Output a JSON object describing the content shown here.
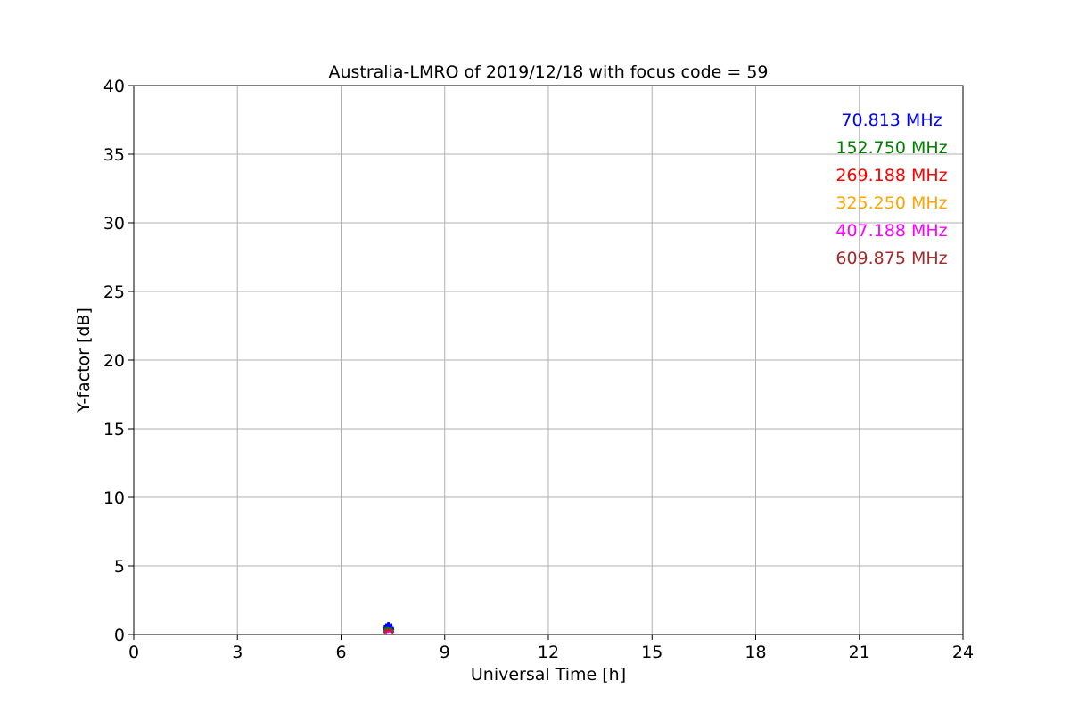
{
  "chart_data": {
    "type": "line",
    "title": "Australia-LMRO of 2019/12/18 with focus code = 59",
    "xlabel": "Universal Time [h]",
    "ylabel": "Y-factor [dB]",
    "xlim": [
      0,
      24
    ],
    "ylim": [
      0,
      40
    ],
    "xticks": [
      0,
      3,
      6,
      9,
      12,
      15,
      18,
      21,
      24
    ],
    "yticks": [
      0,
      5,
      10,
      15,
      20,
      25,
      30,
      35,
      40
    ],
    "xtick_labels": [
      "0",
      "3",
      "6",
      "9",
      "12",
      "15",
      "18",
      "21",
      "24"
    ],
    "ytick_labels": [
      "0",
      "5",
      "10",
      "15",
      "20",
      "25",
      "30",
      "35",
      "40"
    ],
    "grid": true,
    "legend_position": "top-right",
    "series": [
      {
        "name": "70.813 MHz",
        "color": "#0000ff",
        "x": [
          7.25,
          7.27,
          7.29,
          7.31,
          7.33,
          7.35,
          7.37,
          7.39,
          7.41,
          7.43,
          7.45,
          7.47,
          7.49,
          7.51
        ],
        "y": [
          0.3,
          0.7,
          0.4,
          0.8,
          0.5,
          0.6,
          0.9,
          0.4,
          0.7,
          0.5,
          0.8,
          0.4,
          0.6,
          0.3
        ]
      },
      {
        "name": "152.750 MHz",
        "color": "#008000",
        "x": [
          7.25,
          7.28,
          7.31,
          7.34,
          7.37,
          7.4,
          7.43,
          7.46,
          7.49,
          7.51
        ],
        "y": [
          0.2,
          0.4,
          0.3,
          0.5,
          0.4,
          0.45,
          0.35,
          0.4,
          0.3,
          0.2
        ]
      },
      {
        "name": "269.188 MHz",
        "color": "#ff0000",
        "x": [
          7.25,
          7.28,
          7.31,
          7.34,
          7.37,
          7.4,
          7.43,
          7.46,
          7.49,
          7.51
        ],
        "y": [
          0.15,
          0.3,
          0.25,
          0.35,
          0.3,
          0.35,
          0.3,
          0.3,
          0.25,
          0.15
        ]
      },
      {
        "name": "325.250 MHz",
        "color": "#ffa500",
        "x": [
          7.25,
          7.28,
          7.31,
          7.34,
          7.37,
          7.4,
          7.43,
          7.46,
          7.49,
          7.51
        ],
        "y": [
          0.1,
          0.25,
          0.2,
          0.3,
          0.25,
          0.3,
          0.25,
          0.25,
          0.2,
          0.1
        ]
      },
      {
        "name": "407.188 MHz",
        "color": "#ff00ff",
        "x": [
          7.25,
          7.28,
          7.31,
          7.34,
          7.37,
          7.4,
          7.43,
          7.46,
          7.49,
          7.51
        ],
        "y": [
          0.1,
          0.2,
          0.15,
          0.25,
          0.2,
          0.25,
          0.2,
          0.2,
          0.15,
          0.1
        ]
      },
      {
        "name": "609.875 MHz",
        "color": "#a52a2a",
        "x": [
          7.25,
          7.28,
          7.31,
          7.34,
          7.37,
          7.4,
          7.43,
          7.46,
          7.49,
          7.51
        ],
        "y": [
          0.1,
          0.3,
          0.25,
          0.35,
          0.3,
          0.35,
          0.3,
          0.3,
          0.2,
          0.1
        ]
      }
    ]
  }
}
